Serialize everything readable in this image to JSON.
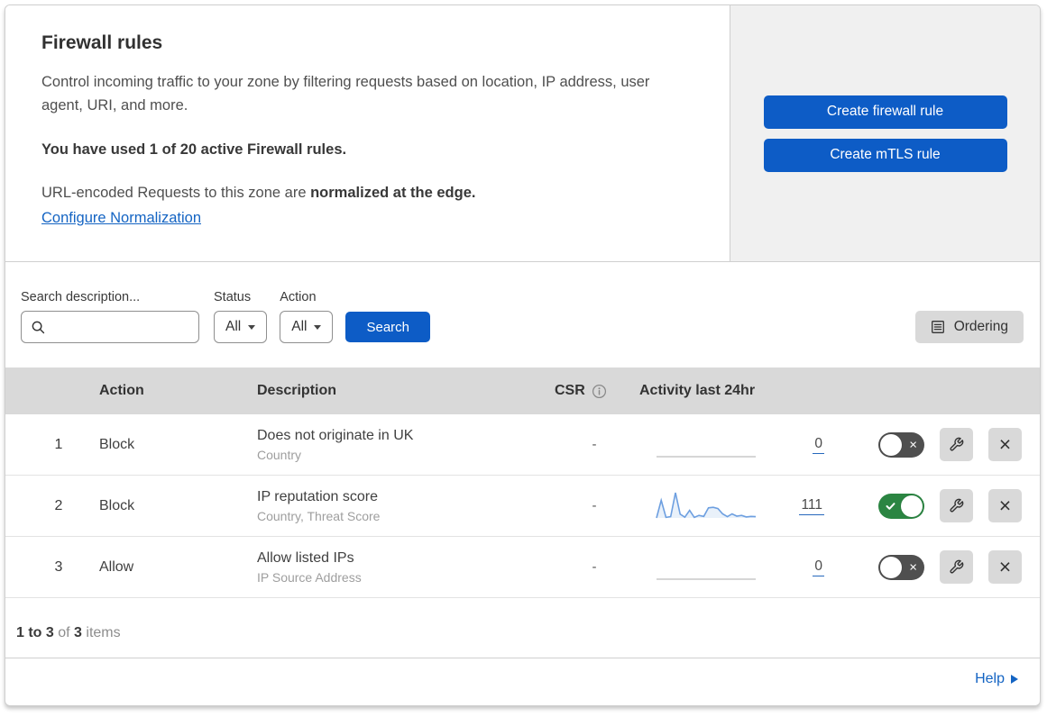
{
  "header": {
    "title": "Firewall rules",
    "description": "Control incoming traffic to your zone by filtering requests based on location, IP address, user agent, URI, and more.",
    "usage_bold": "You have used 1 of 20 active Firewall rules.",
    "normalization_prefix": "URL-encoded Requests to this zone are ",
    "normalization_bold": "normalized at the edge.",
    "normalization_link": "Configure Normalization"
  },
  "actions_panel": {
    "create_firewall_rule_label": "Create firewall rule",
    "create_mtls_rule_label": "Create mTLS rule"
  },
  "filters": {
    "search_label": "Search description...",
    "search_value": "",
    "status_label": "Status",
    "status_value": "All",
    "action_label": "Action",
    "action_value": "All",
    "search_button_label": "Search",
    "ordering_button_label": "Ordering"
  },
  "table": {
    "columns": {
      "action": "Action",
      "description": "Description",
      "csr": "CSR",
      "activity": "Activity last 24hr"
    },
    "rows": [
      {
        "priority": "1",
        "action": "Block",
        "description": "Does not originate in UK",
        "criteria": "Country",
        "csr": "-",
        "activity_count": "0",
        "enabled": false,
        "sparkline": [
          0,
          0
        ]
      },
      {
        "priority": "2",
        "action": "Block",
        "description": "IP reputation score",
        "criteria": "Country, Threat Score",
        "csr": "-",
        "activity_count": "111",
        "enabled": true,
        "sparkline": [
          0,
          70,
          2,
          5,
          100,
          15,
          3,
          30,
          2,
          10,
          6,
          40,
          42,
          37,
          16,
          5,
          16,
          7,
          10,
          4,
          6,
          5
        ]
      },
      {
        "priority": "3",
        "action": "Allow",
        "description": "Allow listed IPs",
        "criteria": "IP Source Address",
        "csr": "-",
        "activity_count": "0",
        "enabled": false,
        "sparkline": [
          0,
          0
        ]
      }
    ]
  },
  "footer": {
    "range_bold": "1 to 3",
    "of_text": " of ",
    "total_bold": "3",
    "items_text": " items",
    "help_link": "Help"
  },
  "colors": {
    "accent_blue": "#0d5cc6",
    "link_blue": "#1464c3",
    "toggle_on_green": "#2b8542",
    "toggle_off_gray": "#4f4f4f",
    "sparkline_blue": "#6d9fe0",
    "sparkline_flat_gray": "#c9c9c9",
    "table_header_gray": "#d9d9d9"
  }
}
